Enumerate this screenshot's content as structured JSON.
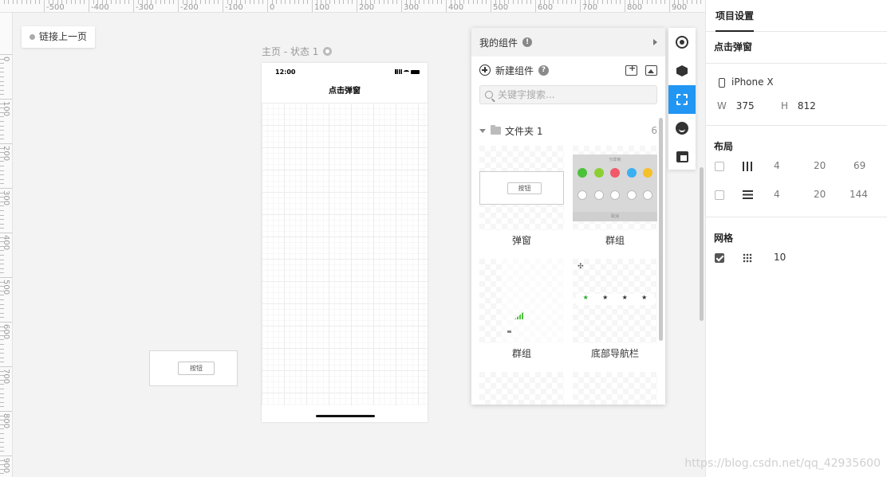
{
  "ruler": {
    "h_labels": [
      "-500",
      "-400",
      "-300",
      "-200",
      "-100",
      "0",
      "100",
      "200",
      "300",
      "400",
      "500",
      "600",
      "700",
      "800",
      "900"
    ],
    "v_labels": [
      "0",
      "100",
      "200",
      "300",
      "400",
      "500",
      "600",
      "700",
      "800",
      "900"
    ]
  },
  "canvas": {
    "link_back_label": "链接上一页",
    "page_state_label": "主页 - 状态 1",
    "phone": {
      "time": "12:00",
      "nav_title": "点击弹窗"
    },
    "floating_button_label": "按钮"
  },
  "library": {
    "title": "我的组件",
    "new_component_label": "新建组件",
    "search_placeholder": "关键字搜索...",
    "folder": {
      "name": "文件夹 1",
      "count": "6"
    },
    "items": [
      {
        "label": "弹窗",
        "inner_button": "按钮"
      },
      {
        "label": "群组",
        "group_title": "分享到",
        "footer": "取消"
      },
      {
        "label": "群组"
      },
      {
        "label": "底部导航栏"
      }
    ]
  },
  "toolbar_icons": [
    "target-icon",
    "cube-icon",
    "frame-icon",
    "emoji-icon",
    "layout-icon"
  ],
  "right_panel": {
    "tab": "项目设置",
    "project_name": "点击弹窗",
    "device": "iPhone X",
    "width_label": "W",
    "width": "375",
    "height_label": "H",
    "height": "812",
    "layout_title": "布局",
    "layout_cols": {
      "count": "4",
      "gutter": "20",
      "size": "69",
      "checked": false
    },
    "layout_rows": {
      "count": "4",
      "gutter": "20",
      "size": "144",
      "checked": false
    },
    "grid_title": "网格",
    "grid_size": "10",
    "grid_checked": true
  },
  "watermark": "https://blog.csdn.net/qq_42935600",
  "colors": {
    "accent": "#2196f3"
  }
}
